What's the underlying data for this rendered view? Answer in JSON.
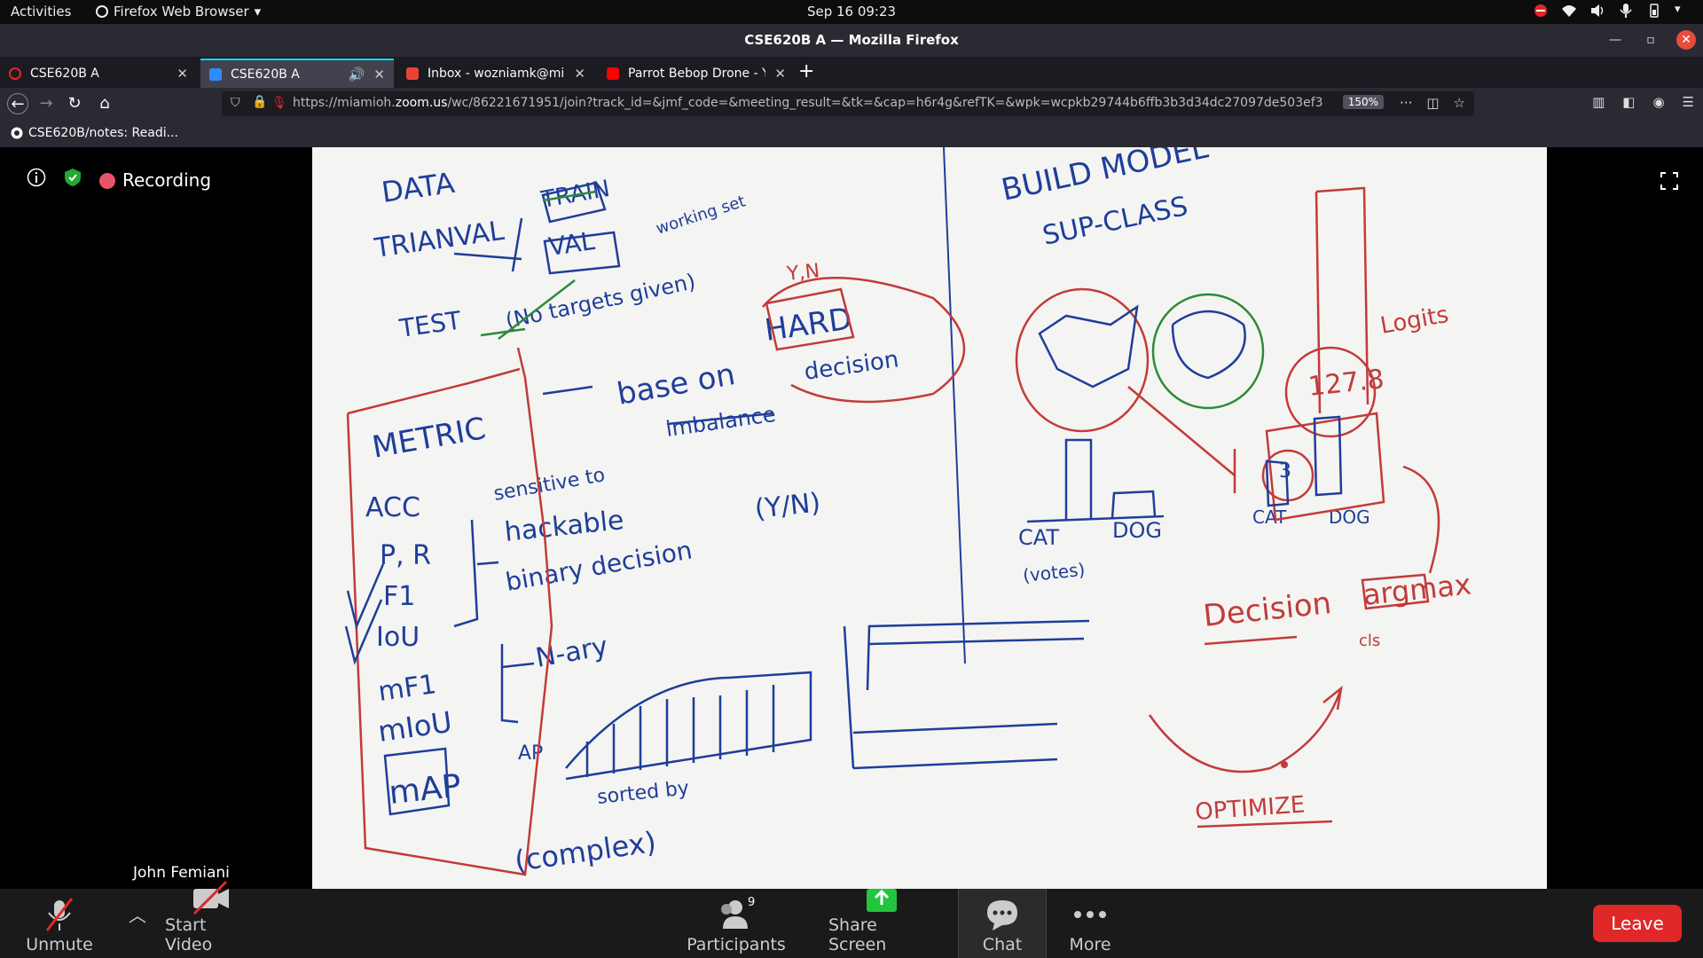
{
  "topbar": {
    "activities": "Activities",
    "app_name": "Firefox Web Browser",
    "clock": "Sep 16  09:23"
  },
  "window": {
    "title": "CSE620B A — Mozilla Firefox"
  },
  "tabs": [
    {
      "label": "CSE620B A",
      "favicon_color": "#e02828",
      "active": false
    },
    {
      "label": "CSE620B A",
      "favicon_color": "#2d8cff",
      "active": true
    },
    {
      "label": "Inbox - wozniamk@miamioh.edu",
      "favicon_color": "#ea4335",
      "active": false
    },
    {
      "label": "Parrot Bebop Drone - YouTube",
      "favicon_color": "#ff0000",
      "active": false
    }
  ],
  "navbar": {
    "url_prefix": "https://miamioh.",
    "url_domain": "zoom.us",
    "url_rest": "/wc/86221671951/join?track_id=&jmf_code=&meeting_result=&tk=&cap=h6r4g&refTK=&wpk=wcpkb29744b6ffb3b3d34dc27097de503ef3",
    "zoom_level": "150%"
  },
  "bookmarks": [
    {
      "label": "CSE620B/notes: Readi..."
    }
  ],
  "meeting": {
    "recording_label": "Recording",
    "speaker_name": "John Femiani",
    "whiteboard_notes": {
      "left": [
        "DATA",
        "TRAIN",
        "TRIANVAL",
        "VAL",
        "working set",
        "TEST",
        "(No targets given)",
        "Y,N",
        "HARD",
        "decision",
        "base on",
        "METRIC",
        "ACC",
        "sensitive to",
        "imbalance",
        "hackable",
        "P, R",
        "F1",
        "IoU",
        "binary decision",
        "(Y/N)",
        "mF1",
        "mIoU",
        "N-ary",
        "mAP",
        "AP",
        "sorted by",
        "(complex)"
      ],
      "right": [
        "BUILD MODEL",
        "SUP-CLASS",
        "Logits",
        "127.8",
        "3",
        "CAT",
        "DOG",
        "(votes)",
        "Decision",
        "argmax",
        "cls",
        "OPTIMIZE"
      ]
    }
  },
  "toolbar": {
    "unmute": "Unmute",
    "start_video": "Start Video",
    "participants": "Participants",
    "participant_count": "9",
    "share_screen": "Share Screen",
    "chat": "Chat",
    "more": "More",
    "leave": "Leave"
  }
}
